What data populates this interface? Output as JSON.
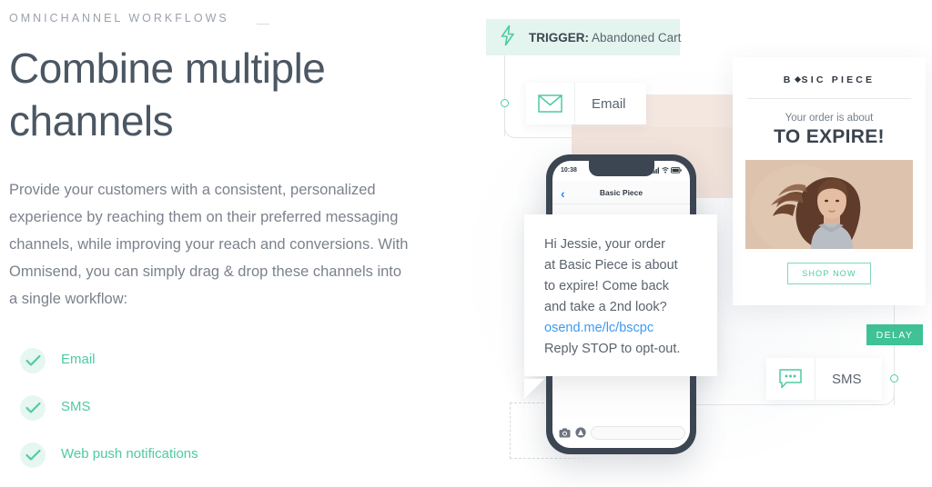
{
  "left": {
    "eyebrow": "OMNICHANNEL WORKFLOWS",
    "headline": "Combine multiple channels",
    "body": "Provide your customers with a consistent, personalized experience by reaching them on their preferred messaging channels, while improving your reach and conversions. With Omnisend, you can simply drag & drop these channels into a single workflow:",
    "checklist": [
      {
        "label": "Email",
        "icon": "check-icon"
      },
      {
        "label": "SMS",
        "icon": "check-icon"
      },
      {
        "label": "Web push notifications",
        "icon": "check-icon"
      }
    ]
  },
  "workflow": {
    "trigger": {
      "icon": "lightning-bolt-icon",
      "label_bold": "TRIGGER:",
      "label_rest": " Abandoned Cart"
    },
    "nodes": [
      {
        "id": "email",
        "label": "Email",
        "icon": "envelope-icon"
      },
      {
        "id": "sms",
        "label": "SMS",
        "icon": "chat-bubble-icon"
      }
    ],
    "delay_badge": "DELAY"
  },
  "email_card": {
    "logo_pre": "B",
    "logo_post": "SIC PIECE",
    "subtitle": "Your order is about",
    "headline": "TO EXPIRE!",
    "photo_alt": "woman-in-grey-tshirt-photo",
    "cta": "SHOP NOW"
  },
  "phone": {
    "status_time": "10:38",
    "nav_back_icon": "chevron-left-icon",
    "nav_title": "Basic Piece",
    "input_placeholder": "",
    "toolbar_icons": [
      "camera-icon",
      "app-store-icon",
      "mic-icon"
    ]
  },
  "sms": {
    "line1": "Hi Jessie, your order",
    "line2": "at Basic Piece is about",
    "line3": "to expire! Come back",
    "line4": "and take a 2nd look?",
    "link": "osend.me/lc/bscpc",
    "line5": "Reply STOP to opt-out."
  },
  "colors": {
    "accent_green": "#4ecaa4",
    "delay_green": "#3fc295",
    "trigger_bg": "#e4f4ee",
    "check_bg": "#e6f6f0",
    "heading": "#4b5763",
    "body_text": "#7b828c",
    "link_blue": "#3d9bf0",
    "beige": "#f4e7e0",
    "phone_frame": "#3c4652"
  }
}
